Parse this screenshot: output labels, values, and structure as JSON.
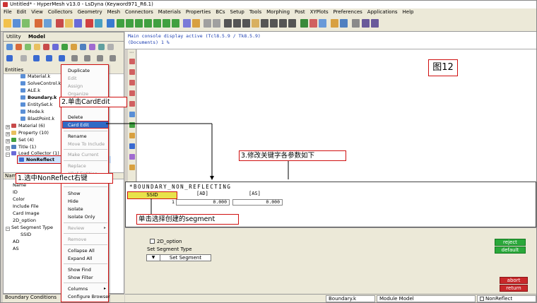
{
  "window": {
    "title": "Untitled* - HyperMesh v13.0 - LsDyna (Keyword971_R6.1)"
  },
  "menubar": [
    "File",
    "Edit",
    "View",
    "Collectors",
    "Geometry",
    "Mesh",
    "Connectors",
    "Materials",
    "Properties",
    "BCs",
    "Setup",
    "Tools",
    "Morphing",
    "Post",
    "XYPlots",
    "Preferences",
    "Applications",
    "Help"
  ],
  "tabs": {
    "utility": "Utility",
    "model": "Model"
  },
  "entities_header": "Entities",
  "tree": [
    {
      "label": "Material.k",
      "bold": false
    },
    {
      "label": "SolveControl.k",
      "bold": false
    },
    {
      "label": "ALE.k",
      "bold": false
    },
    {
      "label": "Boundary.k",
      "bold": true
    },
    {
      "label": "EntitySet.k",
      "bold": false
    },
    {
      "label": "Mode.k",
      "bold": false
    },
    {
      "label": "BlastPoint.k",
      "bold": false
    }
  ],
  "tree_groups": [
    "Material (6)",
    "Property (10)",
    "Set (4)",
    "Title (1)",
    "Load Collector (1)"
  ],
  "selected_item": "NonReflect",
  "name_header": "Name",
  "attributes": [
    "Name",
    "ID",
    "Color",
    "Include File",
    "Card Image",
    "2D_option",
    "Set Segment Type",
    "SSID",
    "AD",
    "AS"
  ],
  "bottom_tab": "Boundary Conditions",
  "context_menu": [
    {
      "label": "Duplicate",
      "disabled": false
    },
    {
      "label": "Edit",
      "disabled": true
    },
    {
      "label": "Assign",
      "disabled": true
    },
    {
      "label": "Organize",
      "disabled": true
    },
    {
      "label": "Delete",
      "disabled": false
    },
    {
      "label": "Card Edit",
      "disabled": false
    },
    {
      "label": "Rename",
      "disabled": false
    },
    {
      "label": "Move To Include",
      "disabled": true
    },
    {
      "label": "Make Current",
      "disabled": true
    },
    {
      "label": "Replace",
      "disabled": true
    },
    {
      "label": "XRef Entities",
      "disabled": true
    },
    {
      "label": "Show",
      "disabled": false
    },
    {
      "label": "Hide",
      "disabled": false
    },
    {
      "label": "Isolate",
      "disabled": false
    },
    {
      "label": "Isolate Only",
      "disabled": false
    },
    {
      "label": "Review",
      "disabled": true
    },
    {
      "label": "Remove",
      "disabled": true
    },
    {
      "label": "Collapse All",
      "disabled": false
    },
    {
      "label": "Expand All",
      "disabled": false
    },
    {
      "label": "Show Find",
      "disabled": false
    },
    {
      "label": "Show Filter",
      "disabled": false
    },
    {
      "label": "Columns",
      "disabled": false
    },
    {
      "label": "Configure Browser",
      "disabled": false
    }
  ],
  "console": {
    "line1": "Main console display active (Tcl8.5.9 / Tk8.5.9)",
    "line2": "(Documents) 1 %"
  },
  "figure_label": "图12",
  "card": {
    "title": "*BOUNDARY_NON_REFLECTING",
    "ssid_label": "SSID",
    "ad_header": "[AD]",
    "as_header": "[AS]",
    "row_number": "1",
    "ad_value": "0.000",
    "as_value": "0.000"
  },
  "panel": {
    "option_2d": "2D_option",
    "set_segment_type": "Set Segment Type",
    "arrow": "▼",
    "set_segment_button": "Set Segment",
    "reject": "reject",
    "default": "default",
    "abort": "abort",
    "return": "return"
  },
  "status": {
    "file": "Boundary.k",
    "module": "Module Model",
    "entity": "NonReflect"
  },
  "annotations": {
    "step1": "1.选中NonReflect右键",
    "step2": "2.单击CardEdit",
    "step3": "3.修改关键字各参数如下",
    "step4": "单击选择创建的segment"
  },
  "colors": {
    "annotation": "#d01010",
    "ssid_button": "#e8e24a",
    "green_button": "#2aa83a",
    "red_button": "#c8282a",
    "selection": "#316ac5"
  }
}
